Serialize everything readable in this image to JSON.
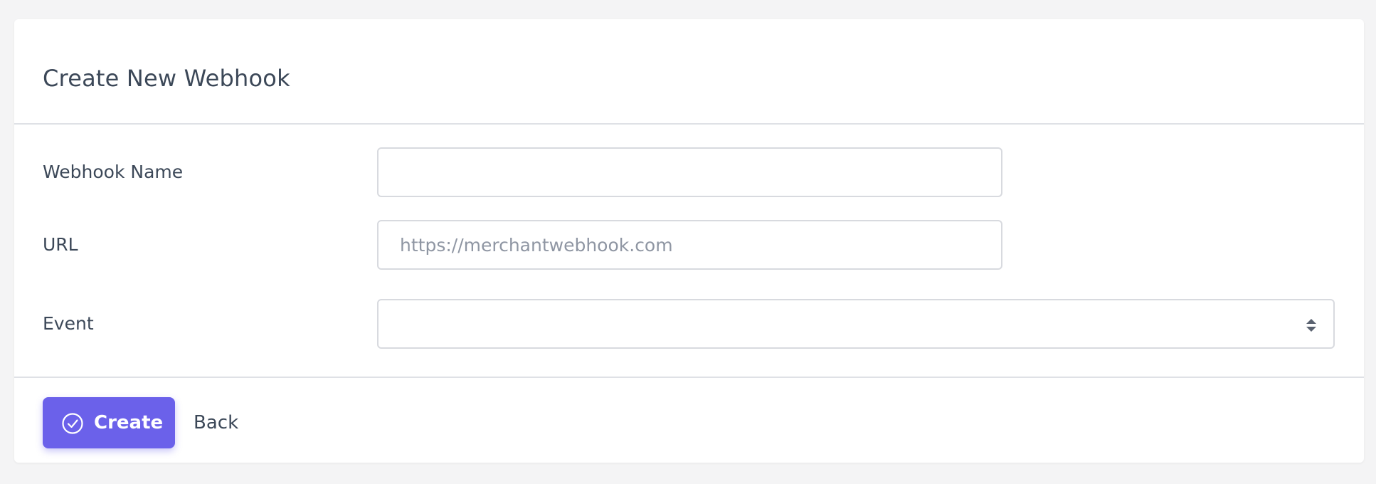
{
  "page": {
    "title": "Create New Webhook"
  },
  "form": {
    "webhook_name": {
      "label": "Webhook Name",
      "value": "",
      "placeholder": ""
    },
    "url": {
      "label": "URL",
      "value": "",
      "placeholder": "https://merchantwebhook.com"
    },
    "event": {
      "label": "Event",
      "selected": "",
      "icon": "sort-arrows-icon"
    }
  },
  "footer": {
    "create_label": "Create",
    "create_icon": "check-circle-icon",
    "back_label": "Back"
  },
  "colors": {
    "accent": "#6b61ea",
    "text": "#3c4858",
    "placeholder": "#8f96a3",
    "border": "#d8dadf"
  }
}
